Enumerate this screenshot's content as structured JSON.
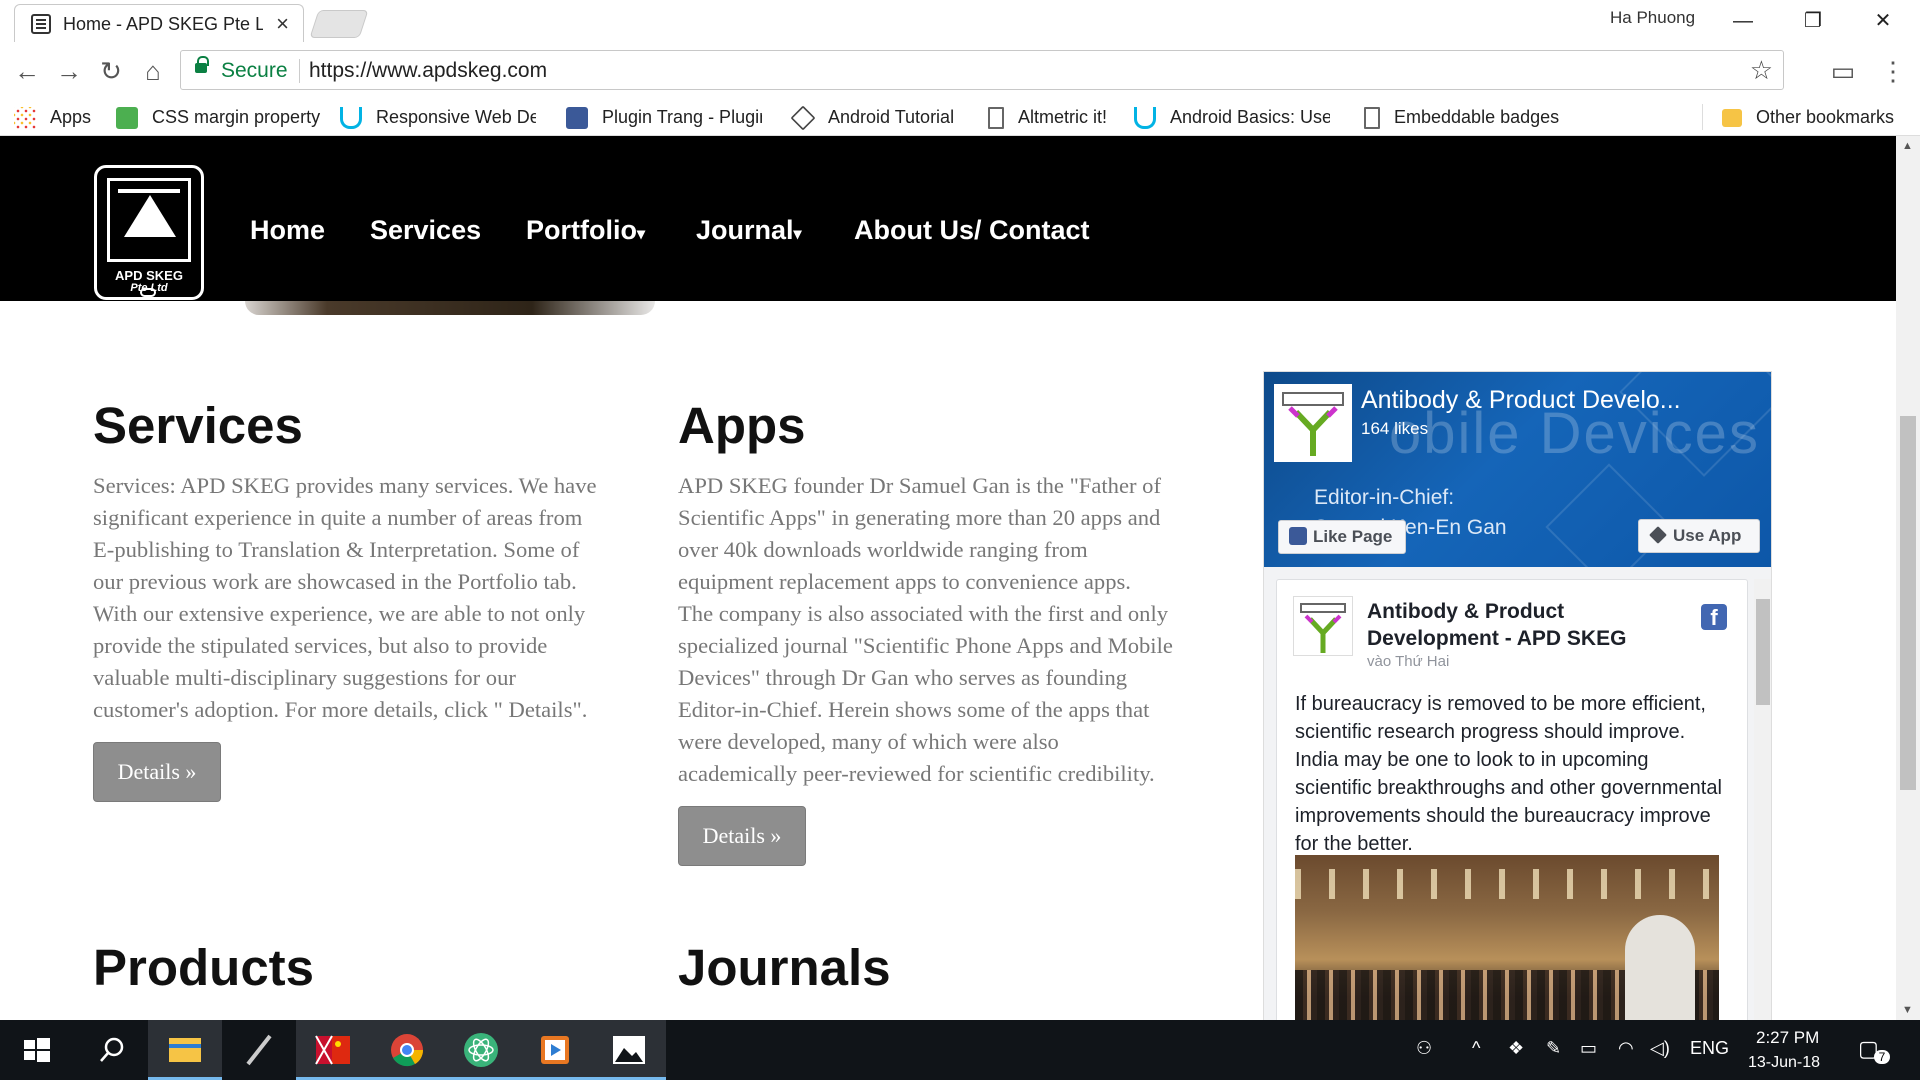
{
  "browser": {
    "tab_title": "Home - APD SKEG Pte Ltd",
    "tab_close": "×",
    "user_name": "Ha Phuong",
    "window_controls": [
      "—",
      "❐",
      "✕"
    ],
    "secure_label": "Secure",
    "url": "https://www.apdskeg.com",
    "bookmarks": [
      {
        "label": "Apps",
        "icon": "apps-grid-icon"
      },
      {
        "label": "CSS margin property",
        "icon": "w3schools-icon"
      },
      {
        "label": "Responsive Web Des",
        "icon": "udacity-icon"
      },
      {
        "label": "Plugin Trang - Plugin",
        "icon": "facebook-icon"
      },
      {
        "label": "Android Tutorial",
        "icon": "diamond-icon"
      },
      {
        "label": "Altmetric it!",
        "icon": "page-icon"
      },
      {
        "label": "Android Basics: User",
        "icon": "udacity-icon"
      },
      {
        "label": "Embeddable badges",
        "icon": "page-icon"
      },
      {
        "label": "Other bookmarks",
        "icon": "folder-icon"
      }
    ]
  },
  "site": {
    "logo_line1": "APD SKEG",
    "logo_line2": "Pte Ltd",
    "nav": [
      {
        "label": "Home",
        "dropdown": false
      },
      {
        "label": "Services",
        "dropdown": false
      },
      {
        "label": "Portfolio",
        "dropdown": true
      },
      {
        "label": "Journal",
        "dropdown": true
      },
      {
        "label": "About Us/ Contact",
        "dropdown": false
      }
    ],
    "dropdown_caret": "▾"
  },
  "sections": {
    "services": {
      "heading": "Services",
      "lines": [
        "Services: APD SKEG provides many services. We have",
        "significant experience in quite a number of areas from",
        "E-publishing to Translation & Interpretation. Some of",
        "our previous work are showcased in the Portfolio tab.",
        "With our extensive experience, we are able to not only",
        "provide the stipulated services, but also to provide",
        "valuable multi-disciplinary suggestions for our",
        "customer's adoption. For more details, click \" Details\"."
      ],
      "button": "Details »"
    },
    "apps": {
      "heading": "Apps",
      "lines": [
        "APD SKEG founder Dr Samuel Gan is the \"Father of",
        "Scientific Apps\" in generating more than 20 apps and",
        "over 40k downloads worldwide ranging from",
        "equipment replacement apps to convenience apps.",
        "The company is also associated with the first and only",
        "specialized journal \"Scientific Phone Apps and Mobile",
        "Devices\" through Dr Gan who serves as founding",
        "Editor-in-Chief. Herein shows some of the apps that",
        "were developed, many of which were also",
        "academically peer-reviewed for scientific credibility."
      ],
      "button": "Details »"
    },
    "products": {
      "heading": "Products"
    },
    "journals": {
      "heading": "Journals"
    }
  },
  "facebook": {
    "page_name": "Antibody & Product Develo...",
    "likes": "164 likes",
    "cover_watermark": "obile Devices",
    "cover_text1": "Editor-in-Chief:",
    "cover_text2": "Samuel Ken-En Gan",
    "like_button": "Like Page",
    "use_app_button": "Use App",
    "post": {
      "author": "Antibody & Product Development - APD SKEG",
      "date": "vào Thứ Hai",
      "text": "If bureaucracy is removed to be more efficient, scientific research progress should improve. India may be one to look to in upcoming scientific breakthroughs and other governmental improvements should the bureaucracy improve for the better."
    }
  },
  "taskbar": {
    "apps": [
      "windows-start-icon",
      "search-icon",
      "file-explorer-icon",
      "pen-icon",
      "flag-app-icon",
      "chrome-icon",
      "atom-icon",
      "media-player-icon",
      "photos-icon"
    ],
    "language": "ENG",
    "time": "2:27 PM",
    "date": "13-Jun-18",
    "notifications": "7"
  },
  "colors": {
    "header_bg": "#000000",
    "secure_green": "#0b8043",
    "fb_blue": "#4267b2",
    "button_gray": "#8e8e8e"
  }
}
